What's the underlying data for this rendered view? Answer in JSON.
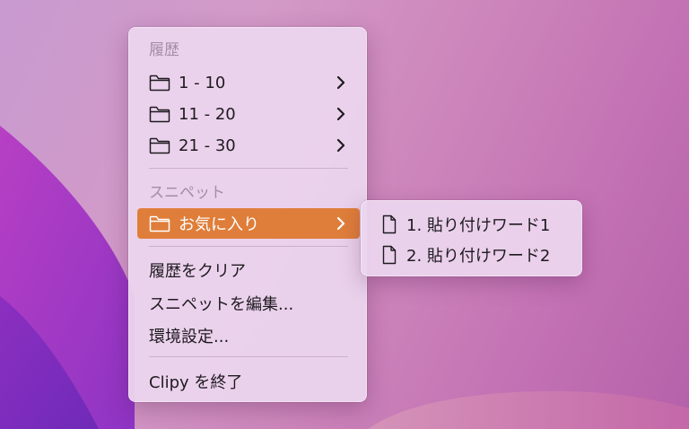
{
  "menu": {
    "history_header": "履歴",
    "history_items": [
      {
        "label": "1 - 10"
      },
      {
        "label": "11 - 20"
      },
      {
        "label": "21 - 30"
      }
    ],
    "snippet_header": "スニペット",
    "snippet_folder": {
      "label": "お気に入り",
      "selected": true
    },
    "clear_history": "履歴をクリア",
    "edit_snippets": "スニペットを編集...",
    "preferences": "環境設定...",
    "quit": "Clipy を終了"
  },
  "submenu": {
    "items": [
      {
        "label": "1. 貼り付けワード1"
      },
      {
        "label": "2. 貼り付けワード2"
      }
    ]
  },
  "colors": {
    "highlight": "#df7e3a",
    "menu_background": "#ecd6ee",
    "header_text": "#a48ca8",
    "item_text": "#1e1a20"
  },
  "icons": {
    "folder": "folder-icon",
    "chevron": "chevron-right-icon",
    "document": "document-icon"
  }
}
